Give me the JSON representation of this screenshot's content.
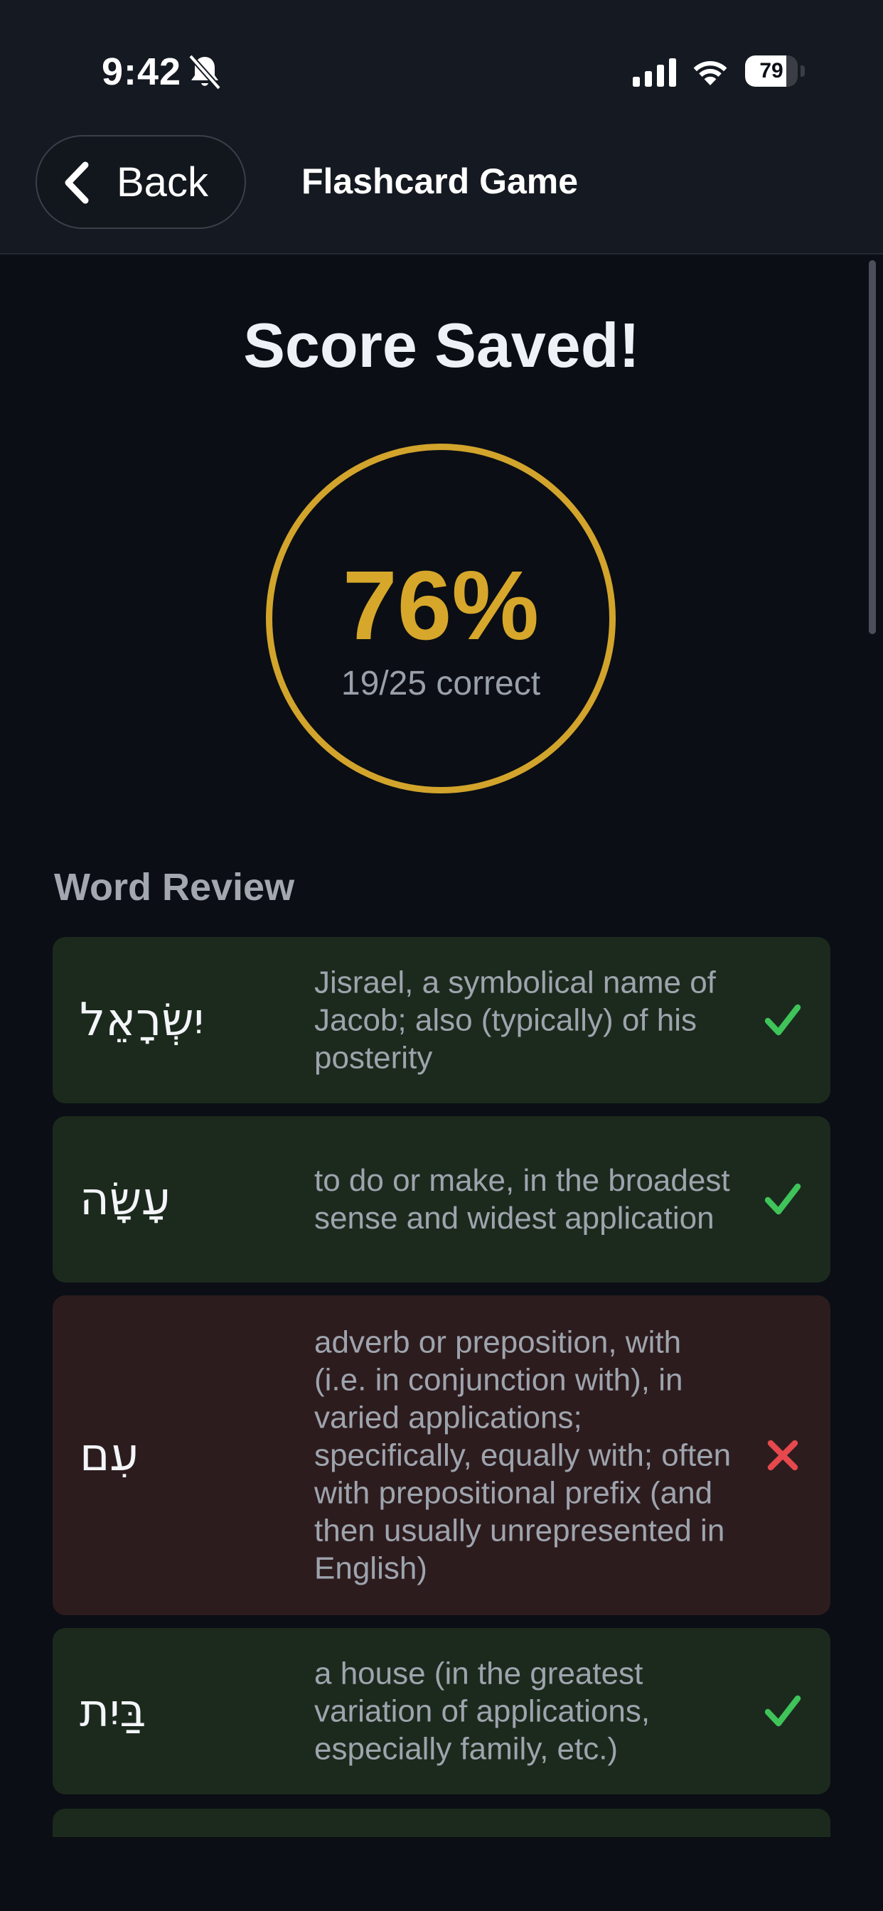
{
  "status_bar": {
    "time": "9:42",
    "battery": "79",
    "battery_level": 0.79,
    "icons": [
      "bell-slash-icon",
      "cellular-signal-icon",
      "wifi-icon",
      "battery-icon"
    ]
  },
  "nav": {
    "back_label": "Back",
    "title": "Flashcard Game"
  },
  "score": {
    "title": "Score Saved!",
    "percent": "76%",
    "correct_text": "19/25 correct",
    "ring_color": "#d2a42c"
  },
  "review": {
    "heading": "Word Review",
    "items": [
      {
        "word": "יִשְׂרָאֵל",
        "definition": "Jisrael, a symbolical name of Jacob; also (typically) of his posterity",
        "result": "correct"
      },
      {
        "word": "עָשָׂה",
        "definition": "to do or make, in the broadest sense and widest application",
        "result": "correct"
      },
      {
        "word": "עִם",
        "definition": "adverb or preposition, with (i.e. in conjunction with), in varied applications; specifically, equally with; often with prepositional prefix (and then usually unrepresented in English)",
        "result": "incorrect"
      },
      {
        "word": "בַּיִת",
        "definition": "a house (in the greatest variation of applications, especially family, etc.)",
        "result": "correct"
      }
    ]
  },
  "colors": {
    "background": "#0b0e14",
    "correct_card": "#1c2a1e",
    "incorrect_card": "#2d1c1e",
    "check": "#3fc45a",
    "cross": "#e5484d",
    "accent_gold": "#d6a72a"
  }
}
